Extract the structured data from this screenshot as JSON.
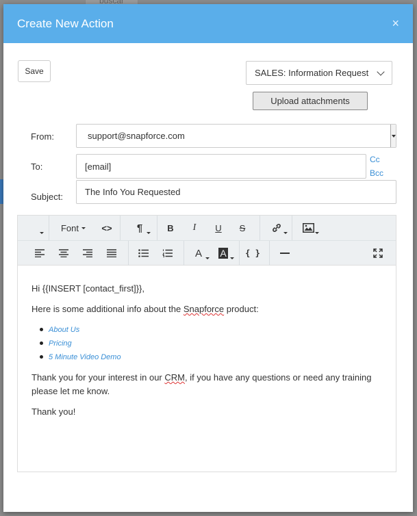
{
  "background": {
    "tab_label": "buscar"
  },
  "modal": {
    "title": "Create New Action",
    "close_glyph": "×"
  },
  "actions": {
    "save_label": "Save",
    "template_value": "SALES: Information Request",
    "upload_label": "Upload attachments"
  },
  "form": {
    "from_label": "From:",
    "from_value": "support@snapforce.com",
    "to_label": "To:",
    "to_value": "[email]",
    "cc_label": "Cc",
    "bcc_label": "Bcc",
    "subject_label": "Subject:",
    "subject_value": "The Info You Requested"
  },
  "toolbar": {
    "font_label": "Font",
    "code_glyph": "<>",
    "paragraph_glyph": "¶",
    "bold_glyph": "B",
    "italic_glyph": "I",
    "underline_glyph": "U",
    "strike_glyph": "S",
    "text_color_glyph": "A",
    "bg_color_glyph": "A",
    "braces_glyph": "{ }"
  },
  "email_body": {
    "greeting": "Hi {{INSERT [contact_first]}},",
    "intro_before": "Here is some additional info about the ",
    "intro_brand": "Snapforce",
    "intro_after": " product:",
    "links": [
      "About Us",
      "Pricing",
      "5 Minute Video Demo"
    ],
    "thanks_before": "Thank you for your interest in our ",
    "thanks_crm": "CRM",
    "thanks_after": ", if you have any questions or need any training please let me know.",
    "signoff": "Thank you!"
  },
  "colors": {
    "header": "#5aaeea",
    "link": "#3a8fd6",
    "toolbar": "#edf0f2"
  }
}
